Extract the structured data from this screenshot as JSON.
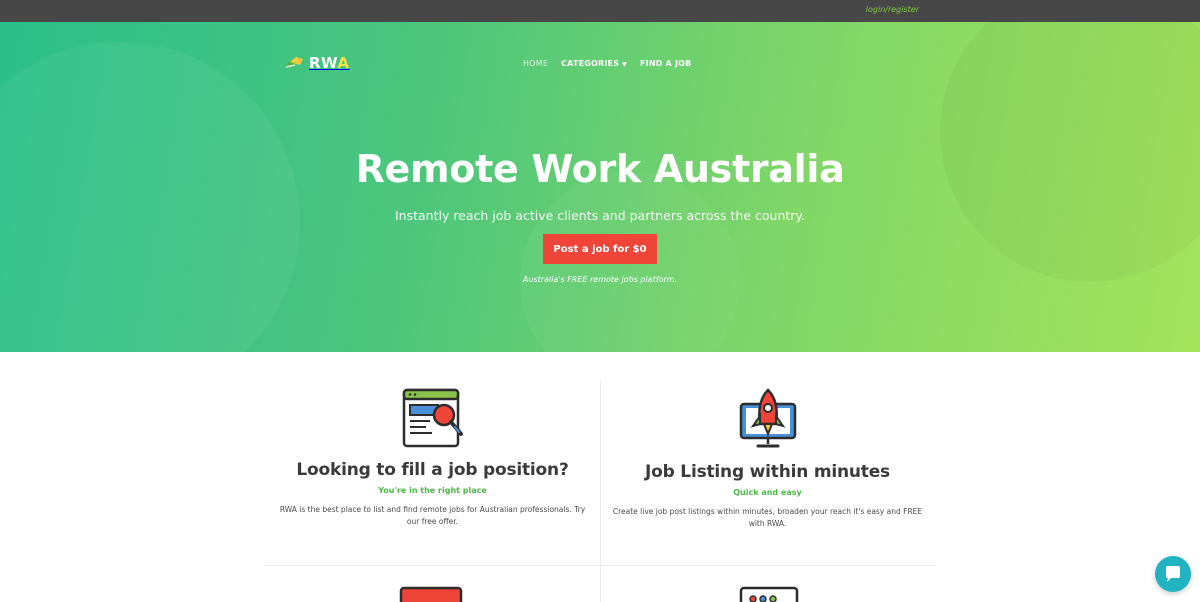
{
  "topbar": {
    "login_label": "login/register"
  },
  "logo": {
    "text_main": "RW",
    "text_accent": "A"
  },
  "nav": {
    "home": "HOME",
    "categories": "CATEGORIES",
    "categories_caret": "▼",
    "find_job": "FIND A JOB"
  },
  "hero": {
    "title": "Remote Work Australia",
    "subtitle": "Instantly reach job active clients and partners across the country.",
    "cta_label": "Post a job for $0",
    "tagline": "Australia's FREE remote jobs platform."
  },
  "features": [
    {
      "icon": "website-search-icon",
      "title": "Looking to fill a job position?",
      "subtitle": "You're in the right place",
      "body": "RWA is the best place to list and find remote jobs for Australian professionals. Try our free offer."
    },
    {
      "icon": "rocket-monitor-icon",
      "title": "Job Listing within minutes",
      "subtitle": "Quick and easy",
      "body": "Create live job post listings within minutes, broaden your reach it's easy and FREE with RWA."
    }
  ],
  "colors": {
    "topbar": "#474747",
    "hero_start": "#2bbf8a",
    "hero_end": "#a3e45a",
    "cta": "#ef4438",
    "accent_green": "#4db848",
    "chat": "#22b3c2"
  }
}
